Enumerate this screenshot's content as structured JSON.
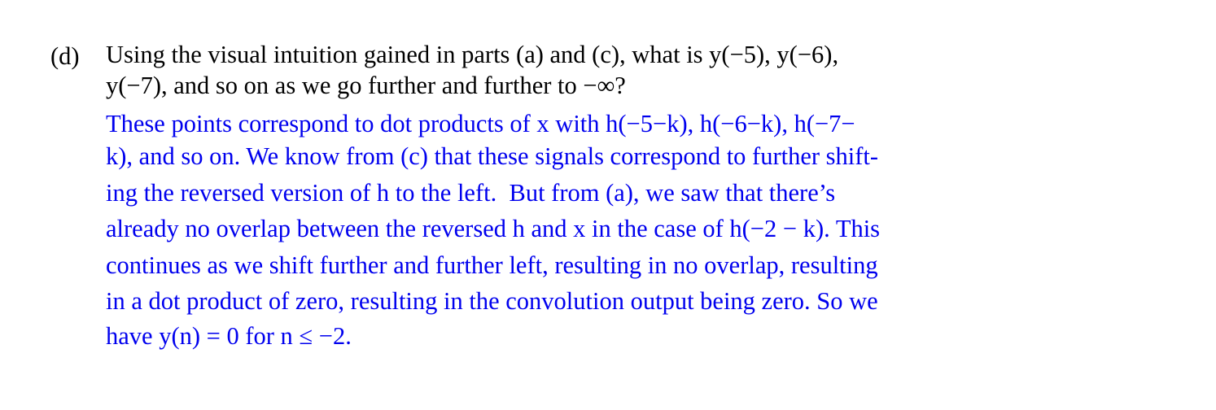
{
  "problem": {
    "label": "(d)",
    "question_lines": [
      "Using the visual intuition gained in parts (a) and (c), what is y(−5), y(−6),",
      "y(−7), and so on as we go further and further to −∞?"
    ],
    "answer_lines": [
      "These points correspond to dot products of x with h(−5−k), h(−6−k), h(−7−",
      "k), and so on. We know from (c) that these signals correspond to further shift-",
      "ing the reversed version of h to the left.  But from (a), we saw that there’s",
      "already no overlap between the reversed h and x in the case of h(−2 − k). This",
      "continues as we shift further and further left, resulting in no overlap, resulting",
      "in a dot product of zero, resulting in the convolution output being zero. So we",
      "have y(n) = 0 for n ≤ −2."
    ]
  },
  "colors": {
    "question": "#000000",
    "answer": "#0000ee",
    "background": "#ffffff"
  }
}
